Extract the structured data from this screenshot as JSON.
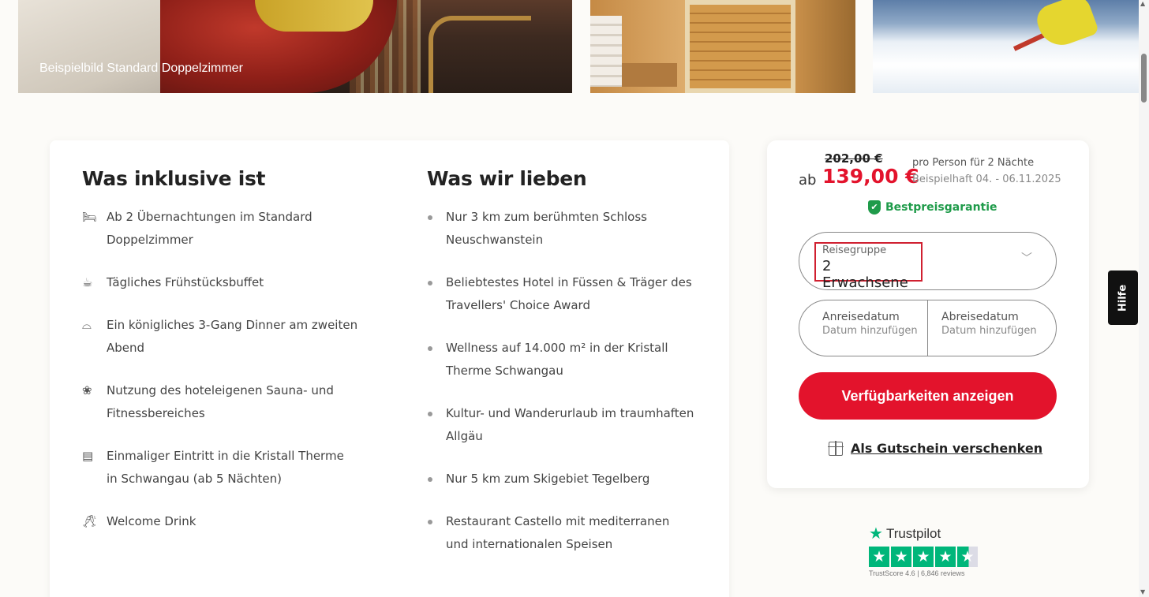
{
  "images": {
    "room_caption": "Beispielbild Standard Doppelzimmer"
  },
  "included": {
    "title": "Was inklusive ist",
    "items": [
      {
        "icon": "bed-icon",
        "text": "Ab 2 Übernachtungen im Standard Doppelzimmer"
      },
      {
        "icon": "coffee-cup-icon",
        "text": "Tägliches Frühstücksbuffet"
      },
      {
        "icon": "cloche-icon",
        "text": "Ein königliches 3-Gang Dinner am zweiten Abend"
      },
      {
        "icon": "lotus-icon",
        "text": "Nutzung des hoteleigenen Sauna- und Fitnessbereiches"
      },
      {
        "icon": "ticket-icon",
        "text": "Einmaliger Eintritt in die Kristall Therme in Schwangau (ab 5 Nächten)"
      },
      {
        "icon": "champagne-icon",
        "text": "Welcome Drink"
      }
    ]
  },
  "love": {
    "title": "Was wir lieben",
    "items": [
      "Nur 3 km zum berühmten Schloss Neuschwanstein",
      "Beliebtestes Hotel in Füssen & Träger des Travellers' Choice Award",
      "Wellness auf 14.000 m² in der Kristall Therme Schwangau",
      "Kultur- und Wanderurlaub im traumhaften Allgäu",
      "Nur 5 km zum Skigebiet Tegelberg",
      "Restaurant Castello mit mediterranen und internationalen Speisen"
    ]
  },
  "booking": {
    "old_price": "202,00 €",
    "ab": "ab",
    "price": "139,00 €",
    "per_person": "pro Person für 2 Nächte",
    "example": "Beispielhaft 04. - 06.11.2025",
    "best_price": "Bestpreisgarantie",
    "group_label": "Reisegruppe",
    "group_value": "2 Erwachsene",
    "arrival_label": "Anreisedatum",
    "arrival_value": "Datum hinzufügen",
    "departure_label": "Abreisedatum",
    "departure_value": "Datum hinzufügen",
    "cta": "Verfügbarkeiten anzeigen",
    "gift": "Als Gutschein verschenken"
  },
  "trustpilot": {
    "brand": "Trustpilot",
    "score": "TrustScore 4.6 | 6,846 reviews",
    "rating": 4.6,
    "color": "#00b67a"
  },
  "help": {
    "label": "Hilfe"
  },
  "colors": {
    "accent": "#e3132c",
    "success": "#1f9b4a"
  }
}
